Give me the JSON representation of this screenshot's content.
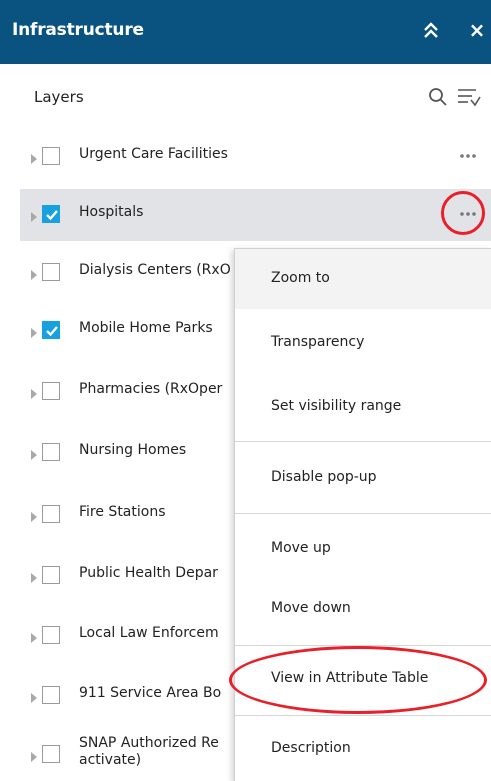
{
  "panel": {
    "title": "Infrastructure",
    "close_glyph": "×",
    "collapse_icon": "double-chevron-up-icon"
  },
  "layers": {
    "heading": "Layers",
    "items": [
      {
        "label": "Urgent Care Facilities",
        "checked": false
      },
      {
        "label": "Hospitals",
        "checked": true
      },
      {
        "label": "Dialysis Centers (RxO",
        "checked": false
      },
      {
        "label": "Mobile Home Parks",
        "checked": true
      },
      {
        "label": "Pharmacies (RxOper",
        "checked": false
      },
      {
        "label": "Nursing Homes",
        "checked": false
      },
      {
        "label": "Fire Stations",
        "checked": false
      },
      {
        "label": "Public Health Depar",
        "checked": false
      },
      {
        "label": "Local Law Enforcem",
        "checked": false
      },
      {
        "label": "911 Service Area Bo",
        "checked": false
      },
      {
        "label": "SNAP Authorized Re activate)",
        "checked": false
      }
    ]
  },
  "context_menu": {
    "items": [
      {
        "label": "Zoom to"
      },
      {
        "label": "Transparency"
      },
      {
        "label": "Set visibility range"
      },
      {
        "label": "Disable pop-up"
      },
      {
        "label": "Move up"
      },
      {
        "label": "Move down"
      },
      {
        "label": "View in Attribute Table"
      },
      {
        "label": "Description"
      }
    ]
  },
  "colors": {
    "header_bg": "#0a5381",
    "checkbox_checked": "#17a1e0",
    "annotation_red": "#e8202a",
    "selected_row_bg": "#e1e3e6"
  }
}
